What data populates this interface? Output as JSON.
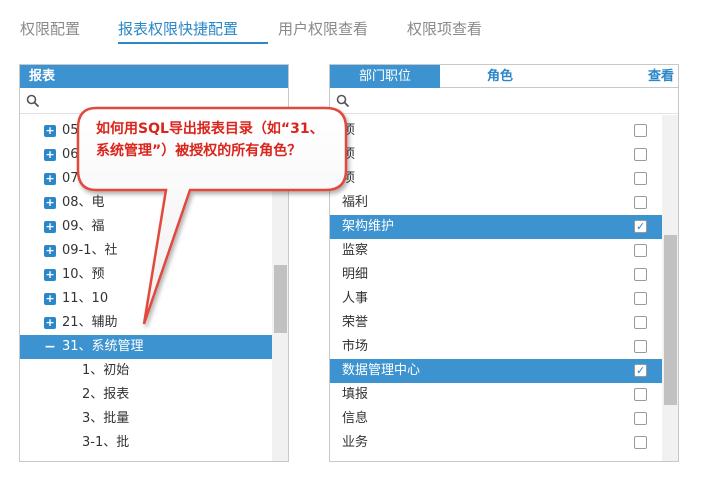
{
  "tabs": [
    {
      "label": "权限配置",
      "active": false
    },
    {
      "label": "报表权限快捷配置",
      "active": true
    },
    {
      "label": "用户权限查看",
      "active": false
    },
    {
      "label": "权限项查看",
      "active": false
    }
  ],
  "left_panel": {
    "header": "报表",
    "tree": [
      {
        "label": "05",
        "expander": "+"
      },
      {
        "label": "06",
        "expander": "+"
      },
      {
        "label": "07",
        "expander": "+"
      },
      {
        "label": "08、电",
        "expander": "+"
      },
      {
        "label": "09、福",
        "expander": "+"
      },
      {
        "label": "09-1、社",
        "expander": "+"
      },
      {
        "label": "10、预",
        "expander": "+"
      },
      {
        "label": "11、10",
        "expander": "+"
      },
      {
        "label": "21、辅助",
        "expander": "+"
      },
      {
        "label": "31、系统管理",
        "expander": "−",
        "selected": true
      }
    ],
    "children": [
      "1、初始",
      "2、报表",
      "3、批量",
      "3-1、批"
    ]
  },
  "right_panel": {
    "tabs": {
      "dept": "部门职位",
      "role": "角色",
      "view": "查看"
    },
    "roles": [
      {
        "label": "项",
        "checked": false,
        "selected": false
      },
      {
        "label": "项",
        "checked": false,
        "selected": false
      },
      {
        "label": "项",
        "checked": false,
        "selected": false
      },
      {
        "label": "福利",
        "checked": false,
        "selected": false
      },
      {
        "label": "架构维护",
        "checked": true,
        "selected": true
      },
      {
        "label": "监察",
        "checked": false,
        "selected": false
      },
      {
        "label": "明细",
        "checked": false,
        "selected": false
      },
      {
        "label": "人事",
        "checked": false,
        "selected": false
      },
      {
        "label": "荣誉",
        "checked": false,
        "selected": false
      },
      {
        "label": "市场",
        "checked": false,
        "selected": false
      },
      {
        "label": "数据管理中心",
        "checked": true,
        "selected": true
      },
      {
        "label": "填报",
        "checked": false,
        "selected": false
      },
      {
        "label": "信息",
        "checked": false,
        "selected": false
      },
      {
        "label": "业务",
        "checked": false,
        "selected": false
      }
    ]
  },
  "callout": {
    "text": "如何用SQL导出报表目录（如“31、系统管理”）被授权的所有角色？"
  },
  "colors": {
    "accent": "#3d93cf",
    "callout_border": "#e14a3e",
    "callout_text": "#d9251c"
  }
}
